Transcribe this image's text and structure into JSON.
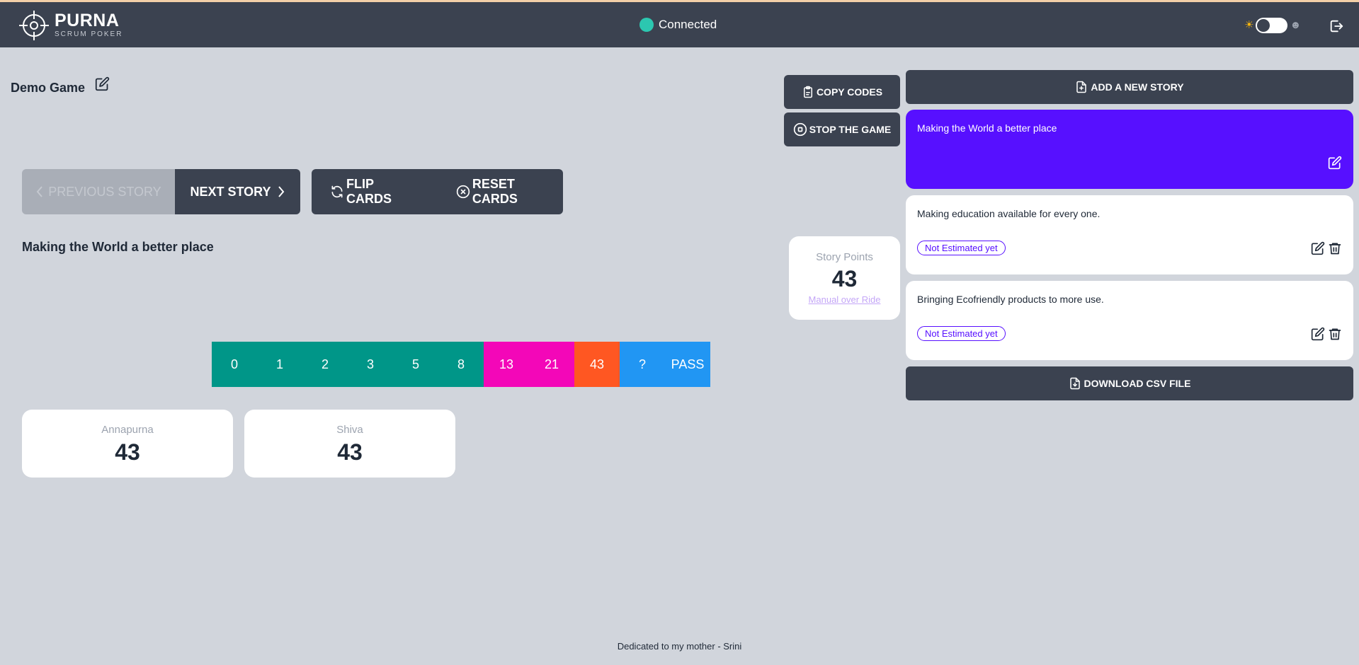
{
  "header": {
    "logo_name": "PURNA",
    "logo_sub": "SCRUM POKER",
    "connection_status": "Connected",
    "connection_color": "#2cc7b0",
    "theme_light_icon": "sun-icon",
    "theme_dark_icon": "moon-icon",
    "logout_icon": "logout-icon"
  },
  "game": {
    "title": "Demo Game",
    "current_story": "Making the World a better place"
  },
  "nav": {
    "previous_label": "PREVIOUS STORY",
    "next_label": "NEXT STORY",
    "flip_label": "FLIP CARDS",
    "reset_label": "RESET CARDS"
  },
  "deck": {
    "cards": [
      {
        "label": "0",
        "color": "#009688"
      },
      {
        "label": "1",
        "color": "#009688"
      },
      {
        "label": "2",
        "color": "#009688"
      },
      {
        "label": "3",
        "color": "#009688"
      },
      {
        "label": "5",
        "color": "#009688"
      },
      {
        "label": "8",
        "color": "#009688"
      },
      {
        "label": "13",
        "color": "#f307b8"
      },
      {
        "label": "21",
        "color": "#f307b8"
      },
      {
        "label": "43",
        "color": "#ff5722"
      },
      {
        "label": "?",
        "color": "#2196f3"
      },
      {
        "label": "PASS",
        "color": "#2196f3"
      }
    ]
  },
  "players": [
    {
      "name": "Annapurna",
      "vote": "43"
    },
    {
      "name": "Shiva",
      "vote": "43"
    }
  ],
  "controls": {
    "copy_codes_label": "COPY CODES",
    "stop_game_label": "STOP THE GAME"
  },
  "story_points": {
    "label": "Story Points",
    "value": "43",
    "override_label": "Manual over Ride"
  },
  "stories": {
    "add_label": "ADD A NEW STORY",
    "download_label": "DOWNLOAD CSV FILE",
    "active_color": "#5710ff",
    "items": [
      {
        "title": "Making the World a better place",
        "badge": ""
      },
      {
        "title": "Making education available for every one.",
        "badge": "Not Estimated yet"
      },
      {
        "title": "Bringing Ecofriendly products to more use.",
        "badge": "Not Estimated yet"
      }
    ]
  },
  "footer": {
    "text": "Dedicated to my mother - Srini"
  }
}
